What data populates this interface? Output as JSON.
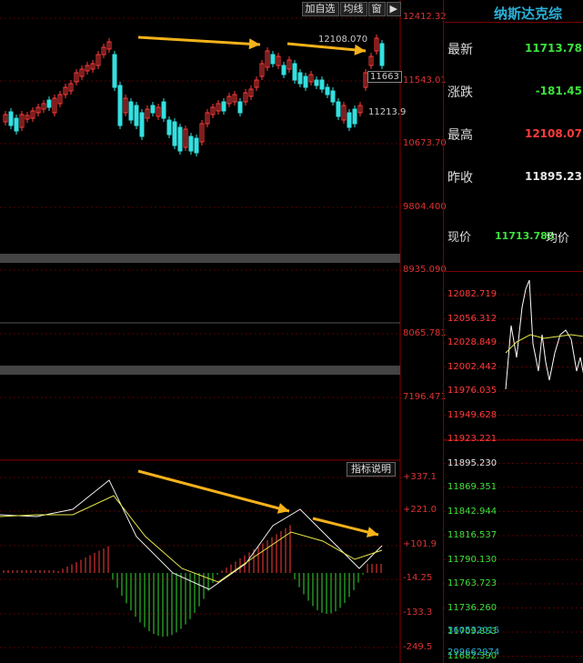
{
  "toolbar": {
    "add_watch": "加自选",
    "ma_line": "均线",
    "window": "窗"
  },
  "main": {
    "price_axis": [
      "12412.32",
      "11543.01",
      "10673.70",
      "9804.400",
      "8935.090",
      "8065.781",
      "7196.471"
    ],
    "high_annotation": "12108.070",
    "low_annotation": "11213.9",
    "current_tag": "11663",
    "indicator_button": "指标说明",
    "macd_axis": [
      "+337.1",
      "+221.0",
      "+101.9",
      "-14.25",
      "-133.3",
      "-249.5"
    ]
  },
  "quote": {
    "title": "纳斯达克综",
    "latest_label": "最新",
    "latest_value": "11713.78",
    "change_label": "涨跌",
    "change_value": "-181.45",
    "high_label": "最高",
    "high_value": "12108.07",
    "prev_close_label": "昨收",
    "prev_close_value": "11895.23",
    "now_label": "现价",
    "now_value": "11713.780",
    "avg_label": "均价"
  },
  "intraday": {
    "axis": [
      "12082.719",
      "12056.312",
      "12028.849",
      "12002.442",
      "11976.035",
      "11949.628",
      "11923.221",
      "11895.230",
      "11869.351",
      "11842.944",
      "11816.537",
      "11790.130",
      "11763.723",
      "11736.260",
      "11709.853",
      "11682.390"
    ],
    "volume": [
      "360532015",
      "299662974"
    ]
  },
  "colors": {
    "up": "#ff3b3b",
    "down": "#33e0e0",
    "arrow": "#f5b21a",
    "macd_pos": "#ff3b3b",
    "macd_neg": "#33dd33"
  }
}
